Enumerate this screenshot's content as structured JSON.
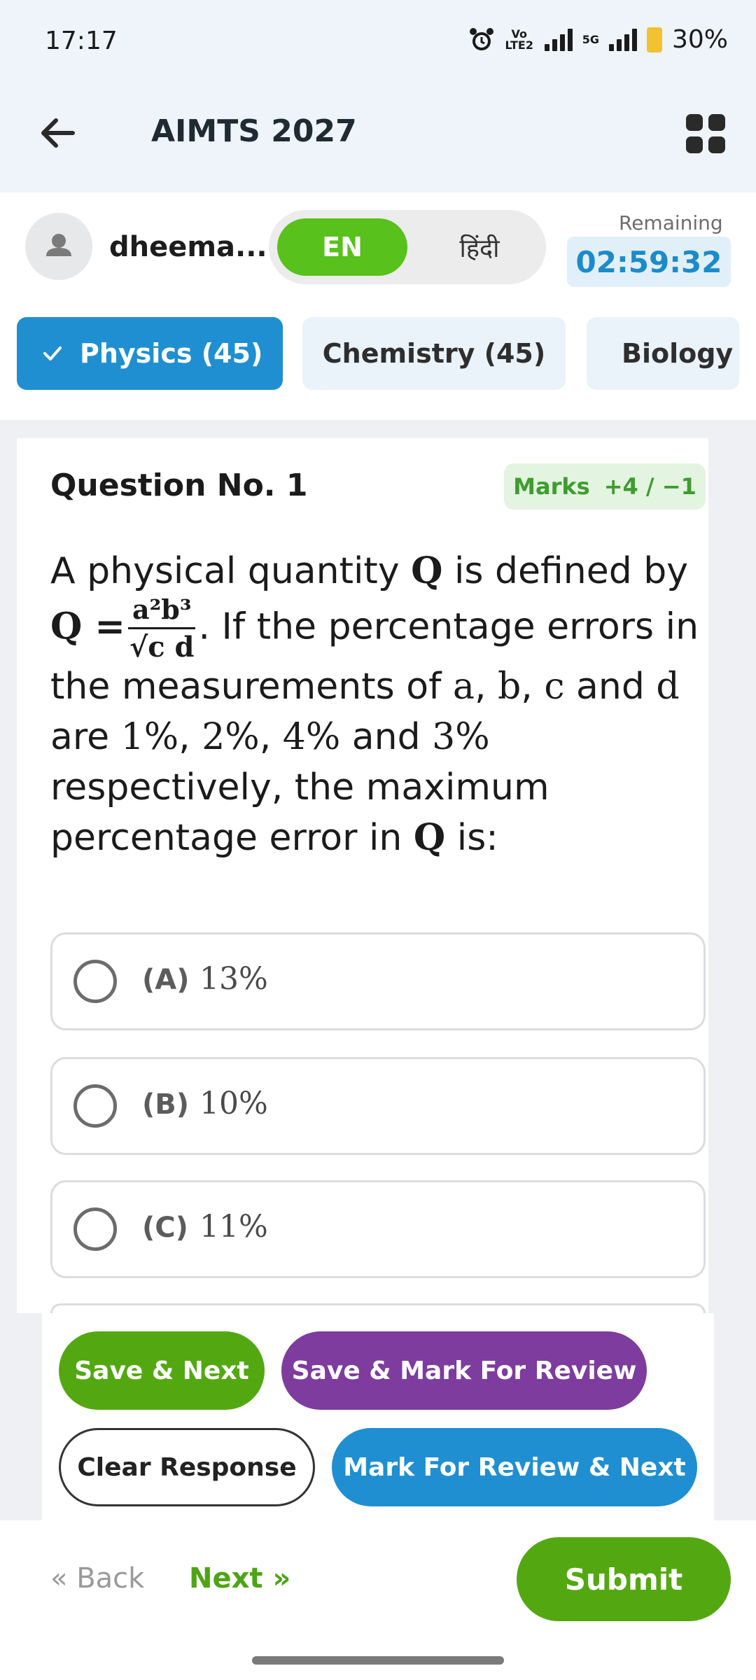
{
  "status_bar": {
    "time": "17:17",
    "network_1": "Vo LTE2",
    "network_2": "5G",
    "battery": "30%"
  },
  "header": {
    "title": "AIMTS 2027",
    "back_icon": "back-arrow-icon",
    "menu_icon": "grid-menu-icon"
  },
  "user": {
    "name": "dheema...",
    "avatar_icon": "person-icon"
  },
  "language": {
    "english": "EN",
    "hindi": "हिंदी",
    "selected": "EN"
  },
  "timer": {
    "label": "Remaining",
    "value": "02:59:32"
  },
  "tabs": [
    {
      "label": "Physics (45)",
      "selected": true
    },
    {
      "label": "Chemistry (45)",
      "selected": false
    },
    {
      "label": "Biology (",
      "selected": false
    }
  ],
  "question": {
    "number_label": "Question No. 1",
    "marks_label": "Marks",
    "marks_value": "+4 / −1",
    "text_1": "A physical quantity ",
    "Q": "Q",
    "text_2": " is defined by ",
    "eq_lhs": "Q =",
    "frac_num": "a²b³",
    "frac_den": "√c d",
    "text_3": ". If the percentage errors in the measurements of ",
    "var_a": "a",
    "var_b": "b",
    "var_c": "c",
    "and_1": " and ",
    "var_d": "d",
    "text_4": " are ",
    "p1": "1%",
    "p2": "2%",
    "p3": "4%",
    "and_2": " and ",
    "p4": "3%",
    "text_5": " respectively, the maximum percentage error in ",
    "text_6": " is:"
  },
  "options": [
    {
      "label": "(A)",
      "value": "13%"
    },
    {
      "label": "(B)",
      "value": "10%"
    },
    {
      "label": "(C)",
      "value": "11%"
    }
  ],
  "actions": {
    "save_next": "Save & Next",
    "save_mark_review": "Save & Mark For Review",
    "clear_response": "Clear Response",
    "mark_review_next": "Mark For Review & Next"
  },
  "nav": {
    "back": "« Back",
    "next": "Next »",
    "submit": "Submit"
  },
  "colors": {
    "primary_blue": "#1f8fd1",
    "green": "#53a812",
    "purple": "#7d3c9e",
    "timer_text": "#1c8bc8"
  }
}
